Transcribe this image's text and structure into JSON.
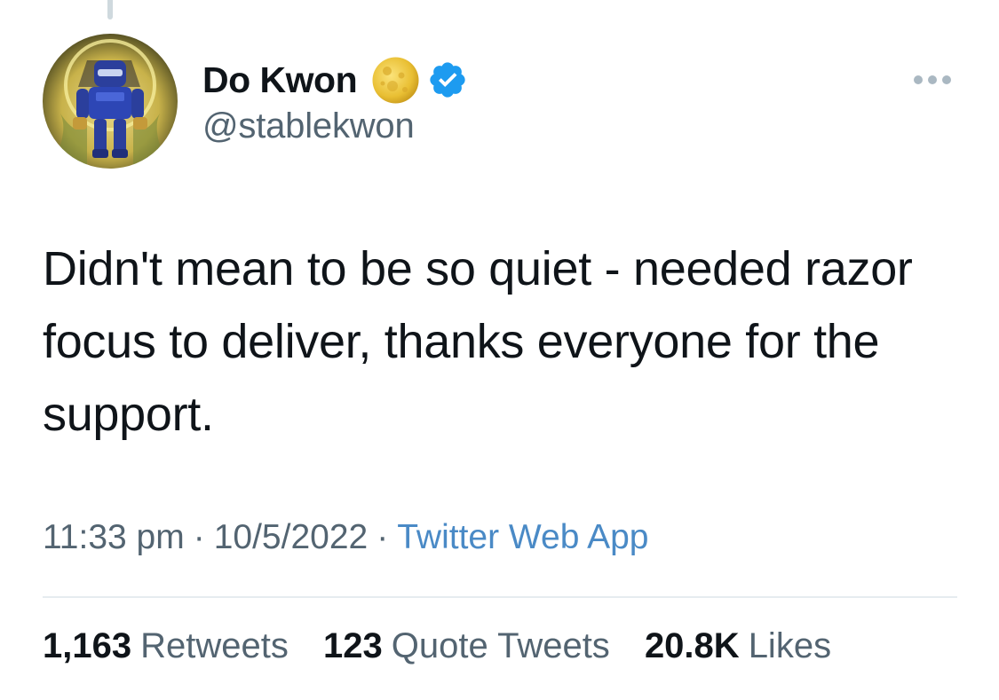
{
  "author": {
    "display_name": "Do Kwon",
    "handle": "@stablekwon",
    "badges": [
      "moon-emoji-icon",
      "verified-badge-icon"
    ]
  },
  "tweet": {
    "text": "Didn't mean to be so quiet - needed razor focus to deliver, thanks everyone for the support.",
    "time": "11:33 pm",
    "date": "10/5/2022",
    "separator": "·",
    "source": "Twitter Web App"
  },
  "stats": {
    "retweets": {
      "count": "1,163",
      "label": "Retweets"
    },
    "quote_tweets": {
      "count": "123",
      "label": "Quote Tweets"
    },
    "likes": {
      "count": "20.8K",
      "label": "Likes"
    }
  },
  "colors": {
    "text_primary": "#0f1419",
    "text_secondary": "#536471",
    "link": "#4a8ac6",
    "verified": "#1d9bf0"
  }
}
